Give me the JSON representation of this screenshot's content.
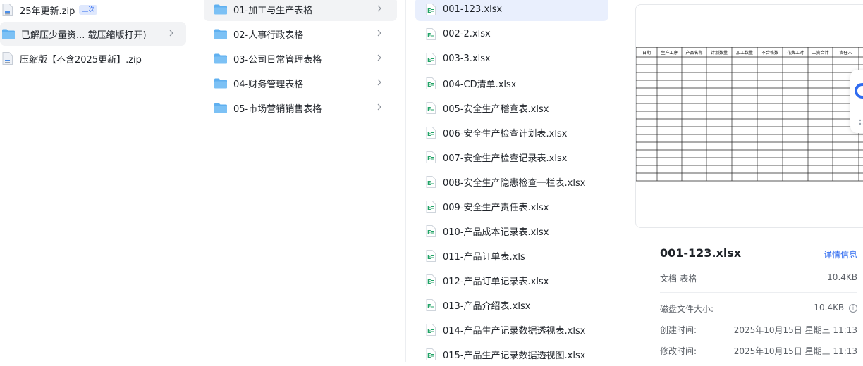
{
  "archives": [
    {
      "label": "25年更新.zip",
      "badge": "上次"
    },
    {
      "label": "已解压少量资... 载压缩版打开)"
    },
    {
      "label": "压缩版【不含2025更新】.zip"
    }
  ],
  "folders": [
    "01-加工与生产表格",
    "02-人事行政表格",
    "03-公司日常管理表格",
    "04-财务管理表格",
    "05-市场营销销售表格"
  ],
  "files": [
    "001-123.xlsx",
    "002-2.xlsx",
    "003-3.xlsx",
    "004-CD清单.xlsx",
    "005-安全生产稽查表.xlsx",
    "006-安全生产检查计划表.xlsx",
    "007-安全生产检查记录表.xlsx",
    "008-安全生产隐患检查一栏表.xlsx",
    "009-安全生产责任表.xlsx",
    "010-产品成本记录表.xlsx",
    "011-产品订单表.xls",
    "012-产品订单记录表.xlsx",
    "013-产品介绍表.xlsx",
    "014-产品生产记录数据透视表.xlsx",
    "015-产品生产记录数据透视图.xlsx"
  ],
  "preview": {
    "headers": [
      "日期",
      "生产工序",
      "产品名称",
      "计划数量",
      "加工数量",
      "不合格数",
      "花费工时",
      "工资合计",
      "责任人"
    ]
  },
  "details": {
    "filename": "001-123.xlsx",
    "detail_link": "详情信息",
    "type_label": "文档-表格",
    "type_size": "10.4KB",
    "disk_label": "磁盘文件大小:",
    "disk_value": "10.4KB",
    "created_label": "创建时间:",
    "created_value": "2025年10月15日 星期三 11:13",
    "modified_label": "修改时间:",
    "modified_value": "2025年10月15日 星期三 11:13"
  },
  "icons": {
    "zip": "zip-file-icon",
    "folder": "folder-icon",
    "excel": "excel-file-icon",
    "chevron": "chevron-right-icon"
  },
  "colors": {
    "accent": "#2f6bf0",
    "folder": "#5fb0f0",
    "excel": "#21a366",
    "selected_blue": "#e9effd",
    "selected_grey": "#f2f3f5"
  }
}
